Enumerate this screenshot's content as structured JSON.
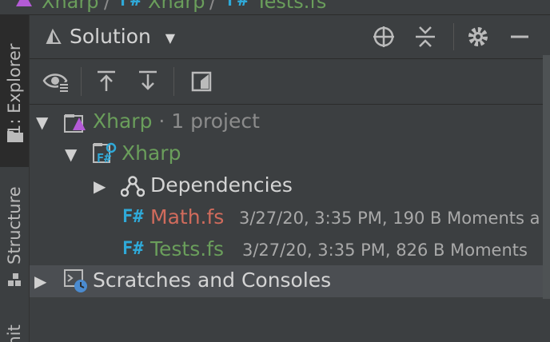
{
  "breadcrumb": {
    "items": [
      "Xharp",
      "Xharp",
      "Tests.fs"
    ],
    "separator": "/"
  },
  "left_strip": {
    "tabs": [
      "1: Explorer",
      "Structure",
      "Unit"
    ]
  },
  "header": {
    "title": "Solution",
    "icons": [
      "locate-icon",
      "collapse-all-icon",
      "gear-icon",
      "minimize-icon"
    ]
  },
  "toolbar": {
    "icons": [
      "show-hidden-icon",
      "sync-up-icon",
      "sync-down-icon",
      "preview-icon"
    ]
  },
  "tree": {
    "solution": {
      "name": "Xharp",
      "meta": " · 1 project"
    },
    "project": {
      "name": "Xharp",
      "badge": "F#"
    },
    "dependencies": {
      "label": "Dependencies"
    },
    "files": [
      {
        "badge": "F#",
        "name": "Math.fs",
        "meta": "3/27/20, 3:35 PM, 190 B Moments a"
      },
      {
        "badge": "F#",
        "name": "Tests.fs",
        "meta": "3/27/20, 3:35 PM, 826 B Moments"
      }
    ],
    "scratches": {
      "label": "Scratches and Consoles"
    }
  },
  "colors": {
    "accent_green": "#6a9e5b",
    "fsharp_blue": "#2fa9d8",
    "modified_red": "#d06b5c",
    "selection": "#4b4e52"
  }
}
